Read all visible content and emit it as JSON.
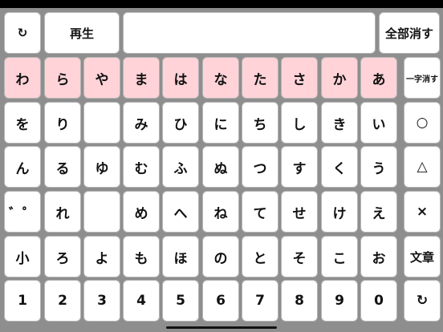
{
  "toolbar": {
    "reset_icon": "↻",
    "play_label": "再生",
    "input_value": "",
    "clear_all_label": "全部消す"
  },
  "side": {
    "delete_one_label": "一字消す",
    "circle_label": "○",
    "triangle_label": "△",
    "cross_label": "×",
    "sentence_label": "文章",
    "reset_icon": "↻"
  },
  "kana_head_row": [
    "わ",
    "ら",
    "や",
    "ま",
    "は",
    "な",
    "た",
    "さ",
    "か",
    "あ"
  ],
  "kana_rows": [
    [
      "を",
      "り",
      "",
      "み",
      "ひ",
      "に",
      "ち",
      "し",
      "き",
      "い"
    ],
    [
      "ん",
      "る",
      "ゆ",
      "む",
      "ふ",
      "ぬ",
      "つ",
      "す",
      "く",
      "う"
    ],
    [
      "゛゜",
      "れ",
      "",
      "め",
      "へ",
      "ね",
      "て",
      "せ",
      "け",
      "え"
    ],
    [
      "小",
      "ろ",
      "よ",
      "も",
      "ほ",
      "の",
      "と",
      "そ",
      "こ",
      "お"
    ]
  ],
  "number_row": [
    "1",
    "2",
    "3",
    "4",
    "5",
    "6",
    "7",
    "8",
    "9",
    "0"
  ],
  "colors": {
    "background": "#8e8e8e",
    "key": "#ffffff",
    "head_row_key": "#ffd3d8"
  }
}
